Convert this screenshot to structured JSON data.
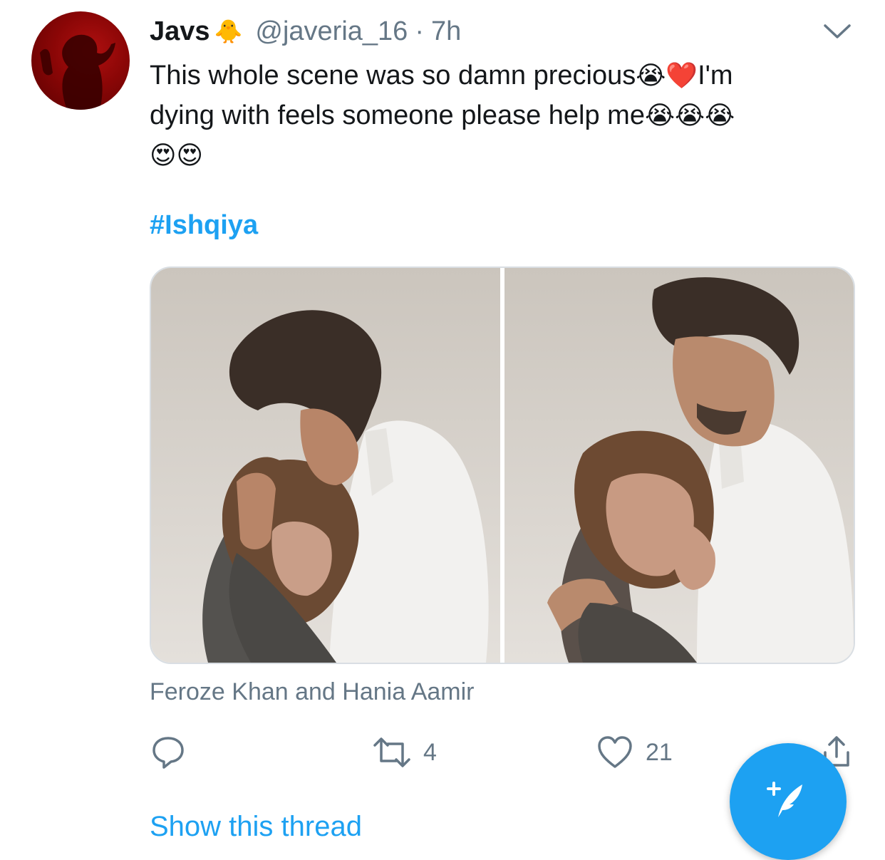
{
  "tweet": {
    "author_name": "Javs",
    "author_emoji": "🐥",
    "handle": "@javeria_16",
    "separator": "·",
    "time": "7h",
    "text_line1": "This whole scene was so damn precious",
    "text_emoji1": "😭❤️",
    "text_line1_end": "I'm",
    "text_line2": "dying with feels someone please help me",
    "text_emoji2": "😭😭😭",
    "text_emoji3": "😍😍",
    "hashtag": "#Ishqiya",
    "media_caption": "Feroze Khan and Hania Aamir"
  },
  "actions": {
    "retweet_count": "4",
    "like_count": "21"
  },
  "show_thread": "Show this thread",
  "icons": {
    "header": [
      "chevron-down-icon"
    ],
    "actions": [
      "reply-icon",
      "retweet-icon",
      "like-icon",
      "share-icon"
    ],
    "fab": "compose-tweet-icon"
  },
  "colors": {
    "accent": "#1da1f2",
    "secondary_text": "#657786",
    "primary_text": "#14171a"
  }
}
